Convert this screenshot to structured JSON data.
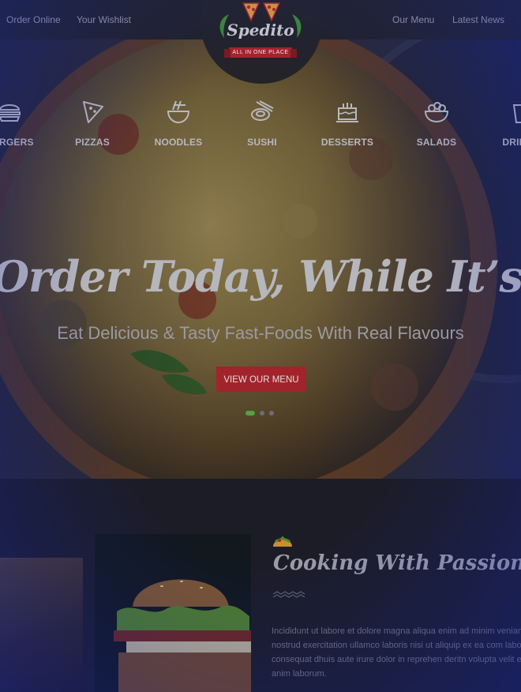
{
  "nav": {
    "left_links": [
      "Order Online",
      "Your Wishlist"
    ],
    "right_links": [
      "Our Menu",
      "Latest News"
    ]
  },
  "logo": {
    "name": "Spedito",
    "tagline": "ALL IN ONE PLACE"
  },
  "categories": [
    {
      "label": "BURGERS",
      "icon": "burger-icon"
    },
    {
      "label": "PIZZAS",
      "icon": "pizza-slice-icon"
    },
    {
      "label": "NOODLES",
      "icon": "noodles-bowl-icon"
    },
    {
      "label": "SUSHI",
      "icon": "sushi-icon"
    },
    {
      "label": "DESSERTS",
      "icon": "cake-icon"
    },
    {
      "label": "SALADS",
      "icon": "salad-bowl-icon"
    },
    {
      "label": "DRINKS",
      "icon": "drink-cup-icon"
    }
  ],
  "hero": {
    "title": "Order Today, While It’s Hot",
    "subtitle": "Eat Delicious & Tasty Fast-Foods With Real Flavours",
    "button": "VIEW OUR MENU",
    "slide_count": 3,
    "active_slide": 1
  },
  "about": {
    "title": "Cooking With Passion",
    "lines": [
      "Incididunt ut labore et dolore magna aliqua enim ad minim veniam",
      "nostrud exercitation ullamco laboris nisi ut aliquip ex ea com labore",
      "consequat dhuis aute irure dolor in reprehen deritn volupta velit e",
      "anim laborum."
    ]
  },
  "colors": {
    "accent_red": "#a3232b",
    "active_dot_green": "#56a040",
    "background": "#1c1c26"
  }
}
